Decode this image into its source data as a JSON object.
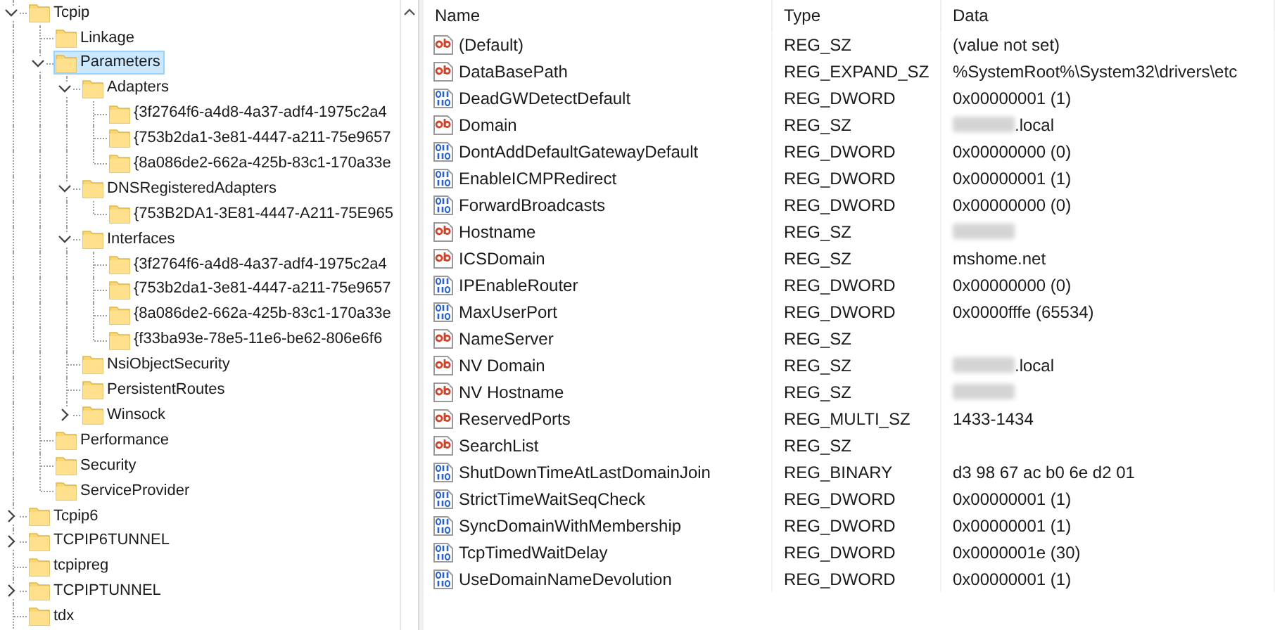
{
  "tree": [
    {
      "label": "Tcpip",
      "expanded": true,
      "has_subkeys": true,
      "selected": false,
      "children": [
        {
          "label": "Linkage",
          "expanded": false,
          "has_subkeys": false,
          "selected": false
        },
        {
          "label": "Parameters",
          "expanded": true,
          "has_subkeys": true,
          "selected": true,
          "children": [
            {
              "label": "Adapters",
              "expanded": true,
              "has_subkeys": true,
              "selected": false,
              "children": [
                {
                  "label": "{3f2764f6-a4d8-4a37-adf4-1975c2a4",
                  "expanded": false,
                  "has_subkeys": false,
                  "selected": false
                },
                {
                  "label": "{753b2da1-3e81-4447-a211-75e9657",
                  "expanded": false,
                  "has_subkeys": false,
                  "selected": false
                },
                {
                  "label": "{8a086de2-662a-425b-83c1-170a33e",
                  "expanded": false,
                  "has_subkeys": false,
                  "selected": false
                }
              ]
            },
            {
              "label": "DNSRegisteredAdapters",
              "expanded": true,
              "has_subkeys": true,
              "selected": false,
              "children": [
                {
                  "label": "{753B2DA1-3E81-4447-A211-75E965",
                  "expanded": false,
                  "has_subkeys": false,
                  "selected": false
                }
              ]
            },
            {
              "label": "Interfaces",
              "expanded": true,
              "has_subkeys": true,
              "selected": false,
              "children": [
                {
                  "label": "{3f2764f6-a4d8-4a37-adf4-1975c2a4",
                  "expanded": false,
                  "has_subkeys": false,
                  "selected": false
                },
                {
                  "label": "{753b2da1-3e81-4447-a211-75e9657",
                  "expanded": false,
                  "has_subkeys": false,
                  "selected": false
                },
                {
                  "label": "{8a086de2-662a-425b-83c1-170a33e",
                  "expanded": false,
                  "has_subkeys": false,
                  "selected": false
                },
                {
                  "label": "{f33ba93e-78e5-11e6-be62-806e6f6",
                  "expanded": false,
                  "has_subkeys": false,
                  "selected": false
                }
              ]
            },
            {
              "label": "NsiObjectSecurity",
              "expanded": false,
              "has_subkeys": false,
              "selected": false
            },
            {
              "label": "PersistentRoutes",
              "expanded": false,
              "has_subkeys": false,
              "selected": false
            },
            {
              "label": "Winsock",
              "expanded": false,
              "has_subkeys": true,
              "selected": false
            }
          ]
        },
        {
          "label": "Performance",
          "expanded": false,
          "has_subkeys": false,
          "selected": false
        },
        {
          "label": "Security",
          "expanded": false,
          "has_subkeys": false,
          "selected": false
        },
        {
          "label": "ServiceProvider",
          "expanded": false,
          "has_subkeys": false,
          "selected": false
        }
      ]
    },
    {
      "label": "Tcpip6",
      "expanded": false,
      "has_subkeys": true,
      "selected": false
    },
    {
      "label": "TCPIP6TUNNEL",
      "expanded": false,
      "has_subkeys": true,
      "selected": false
    },
    {
      "label": "tcpipreg",
      "expanded": false,
      "has_subkeys": false,
      "selected": false
    },
    {
      "label": "TCPIPTUNNEL",
      "expanded": false,
      "has_subkeys": true,
      "selected": false
    },
    {
      "label": "tdx",
      "expanded": false,
      "has_subkeys": false,
      "selected": false
    }
  ],
  "values": {
    "columns": [
      "Name",
      "Type",
      "Data"
    ],
    "rows": [
      {
        "kind": "string",
        "name": "(Default)",
        "type": "REG_SZ",
        "data": "(value not set)",
        "redacted": false
      },
      {
        "kind": "string",
        "name": "DataBasePath",
        "type": "REG_EXPAND_SZ",
        "data": "%SystemRoot%\\System32\\drivers\\etc",
        "redacted": false
      },
      {
        "kind": "binary",
        "name": "DeadGWDetectDefault",
        "type": "REG_DWORD",
        "data": "0x00000001 (1)",
        "redacted": false
      },
      {
        "kind": "string",
        "name": "Domain",
        "type": "REG_SZ",
        "data": ".local",
        "redacted": true
      },
      {
        "kind": "binary",
        "name": "DontAddDefaultGatewayDefault",
        "type": "REG_DWORD",
        "data": "0x00000000 (0)",
        "redacted": false
      },
      {
        "kind": "binary",
        "name": "EnableICMPRedirect",
        "type": "REG_DWORD",
        "data": "0x00000001 (1)",
        "redacted": false
      },
      {
        "kind": "binary",
        "name": "ForwardBroadcasts",
        "type": "REG_DWORD",
        "data": "0x00000000 (0)",
        "redacted": false
      },
      {
        "kind": "string",
        "name": "Hostname",
        "type": "REG_SZ",
        "redacted": true
      },
      {
        "kind": "string",
        "name": "ICSDomain",
        "type": "REG_SZ",
        "data": "mshome.net",
        "redacted": false
      },
      {
        "kind": "binary",
        "name": "IPEnableRouter",
        "type": "REG_DWORD",
        "data": "0x00000000 (0)",
        "redacted": false
      },
      {
        "kind": "binary",
        "name": "MaxUserPort",
        "type": "REG_DWORD",
        "data": "0x0000fffe (65534)",
        "redacted": false
      },
      {
        "kind": "string",
        "name": "NameServer",
        "type": "REG_SZ",
        "redacted": false
      },
      {
        "kind": "string",
        "name": "NV Domain",
        "type": "REG_SZ",
        "data": ".local",
        "redacted": true
      },
      {
        "kind": "string",
        "name": "NV Hostname",
        "type": "REG_SZ",
        "redacted": true
      },
      {
        "kind": "string",
        "name": "ReservedPorts",
        "type": "REG_MULTI_SZ",
        "data": "1433-1434",
        "redacted": false
      },
      {
        "kind": "string",
        "name": "SearchList",
        "type": "REG_SZ",
        "redacted": false
      },
      {
        "kind": "binary",
        "name": "ShutDownTimeAtLastDomainJoin",
        "type": "REG_BINARY",
        "data": "d3 98 67 ac b0 6e d2 01",
        "redacted": false
      },
      {
        "kind": "binary",
        "name": "StrictTimeWaitSeqCheck",
        "type": "REG_DWORD",
        "data": "0x00000001 (1)",
        "redacted": false
      },
      {
        "kind": "binary",
        "name": "SyncDomainWithMembership",
        "type": "REG_DWORD",
        "data": "0x00000001 (1)",
        "redacted": false
      },
      {
        "kind": "binary",
        "name": "TcpTimedWaitDelay",
        "type": "REG_DWORD",
        "data": "0x0000001e (30)",
        "redacted": false
      },
      {
        "kind": "binary",
        "name": "UseDomainNameDevolution",
        "type": "REG_DWORD",
        "data": "0x00000001 (1)",
        "redacted": false
      }
    ]
  }
}
